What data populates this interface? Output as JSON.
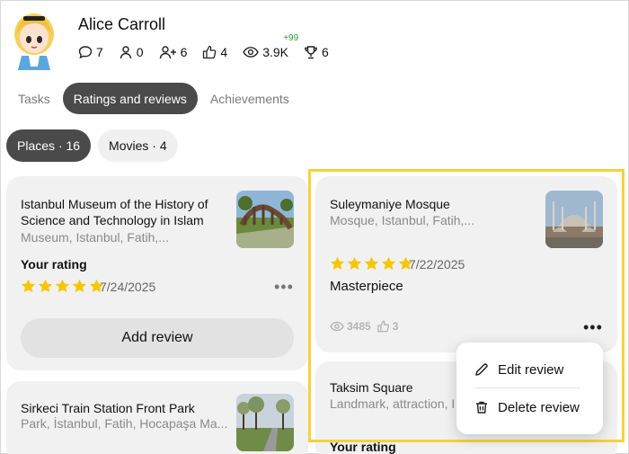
{
  "profile": {
    "name": "Alice Carroll",
    "stats": {
      "comments": "7",
      "following": "0",
      "followers": "6",
      "likes": "4",
      "views": "3.9K",
      "views_delta": "+99",
      "trophies": "6"
    }
  },
  "tabs": [
    "Tasks",
    "Ratings and reviews",
    "Achievements"
  ],
  "chips": [
    "Places · 16",
    "Movies · 4"
  ],
  "cards": {
    "museum": {
      "title_line1": "Istanbul Museum of the History of",
      "title_line2": "Science and Technology in Islam",
      "subtitle": "Museum, Istanbul, Fatih,...",
      "rating_label": "Your rating",
      "date": "7/24/2025",
      "add_review": "Add review"
    },
    "mosque": {
      "title": "Suleymaniye Mosque",
      "subtitle": "Mosque, Istanbul, Fatih,...",
      "date": "7/22/2025",
      "review": "Masterpiece",
      "views": "3485",
      "likes": "3"
    },
    "park": {
      "title": "Sirkeci Train Station Front Park",
      "subtitle": "Park, İstanbul, Fatih, Hocapaşa Ma..."
    },
    "taksim": {
      "title": "Taksim Square",
      "subtitle": "Landmark, attraction, I",
      "rating_label": "Your rating"
    }
  },
  "menu": {
    "edit": "Edit review",
    "delete": "Delete review"
  },
  "colors": {
    "star": "#f7c600",
    "highlight": "#f5d23a",
    "active_tab": "#4a4a4a",
    "delta": "#2a9d3a"
  }
}
